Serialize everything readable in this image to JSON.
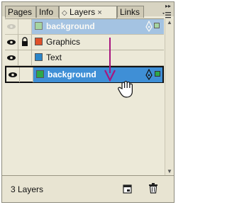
{
  "tabs": [
    {
      "label": "Pages"
    },
    {
      "label": "Info"
    },
    {
      "label": "Layers"
    },
    {
      "label": "Links"
    }
  ],
  "layers": [
    {
      "name": "background",
      "color": "#8fcf8f",
      "state": "drag-ghost"
    },
    {
      "name": "Graphics",
      "color": "#e0502a",
      "state": "normal",
      "locked": true
    },
    {
      "name": "Text",
      "color": "#2b86c9",
      "state": "normal",
      "locked": false
    },
    {
      "name": "background",
      "color": "#2da84a",
      "state": "selected-target"
    }
  ],
  "footer": {
    "status": "3 Layers"
  },
  "colors": {
    "accent": "#3f8fd6",
    "drag_arrow": "#a8157f"
  },
  "icons": [
    "eye-icon",
    "lock-icon",
    "pen-icon",
    "hand-cursor-icon",
    "new-layer-icon",
    "trash-icon",
    "panel-menu-icon",
    "collapse-icon"
  ]
}
